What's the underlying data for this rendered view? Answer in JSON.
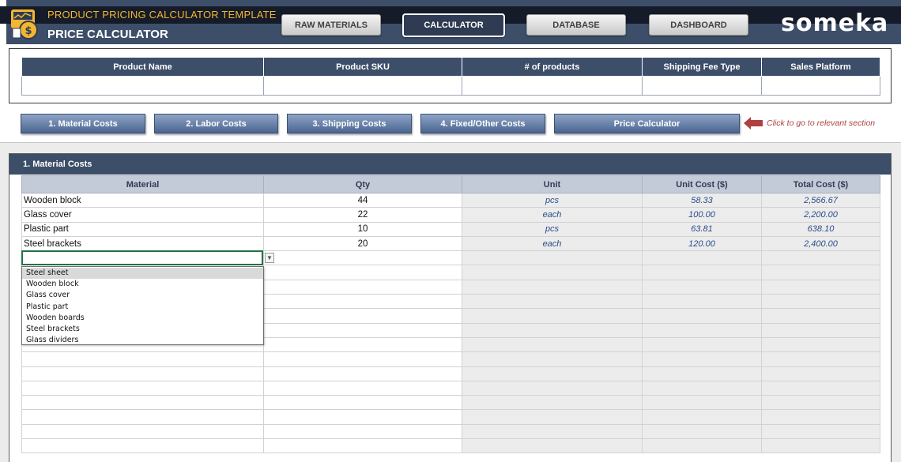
{
  "header": {
    "app_title": "PRODUCT PRICING CALCULATOR TEMPLATE",
    "page_title": "PRICE CALCULATOR",
    "brand": "someka",
    "nav": [
      {
        "label": "RAW MATERIALS",
        "active": false
      },
      {
        "label": "CALCULATOR",
        "active": true
      },
      {
        "label": "DATABASE",
        "active": false
      },
      {
        "label": "DASHBOARD",
        "active": false
      }
    ]
  },
  "product_info": {
    "columns": [
      "Product Name",
      "Product SKU",
      "# of products",
      "Shipping Fee Type",
      "Sales Platform"
    ]
  },
  "section_buttons": [
    "1. Material Costs",
    "2. Labor Costs",
    "3. Shipping Costs",
    "4. Fixed/Other Costs",
    "Price Calculator"
  ],
  "hint": "Click to go to relevant section",
  "material_costs": {
    "title": "1. Material Costs",
    "columns": [
      "Material",
      "Qty",
      "Unit",
      "Unit Cost ($)",
      "Total Cost ($)"
    ],
    "rows": [
      {
        "material": "Wooden block",
        "qty": "44",
        "unit": "pcs",
        "unit_cost": "58.33",
        "total": "2,566.67"
      },
      {
        "material": "Glass cover",
        "qty": "22",
        "unit": "each",
        "unit_cost": "100.00",
        "total": "2,200.00"
      },
      {
        "material": "Plastic part",
        "qty": "10",
        "unit": "pcs",
        "unit_cost": "63.81",
        "total": "638.10"
      },
      {
        "material": "Steel brackets",
        "qty": "20",
        "unit": "each",
        "unit_cost": "120.00",
        "total": "2,400.00"
      }
    ]
  },
  "dropdown": {
    "options": [
      "Steel sheet",
      "Wooden block",
      "Glass cover",
      "Plastic part",
      "Wooden boards",
      "Steel brackets",
      "Glass dividers"
    ],
    "highlighted": "Steel sheet"
  },
  "colors": {
    "header_bg": "#3d4e69",
    "title_accent": "#f2b632",
    "button_blue": "#4a6591",
    "hint_red": "#b04040",
    "value_blue": "#2a4c8c"
  }
}
